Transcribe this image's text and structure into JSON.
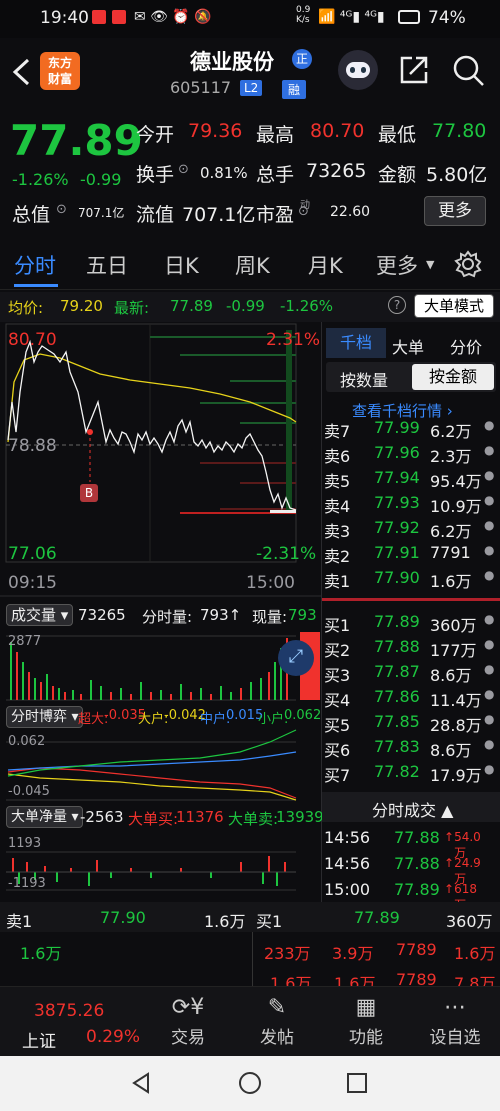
{
  "status": {
    "time": "19:40",
    "net_speed": "0.9\nK/s",
    "battery": "74%"
  },
  "header": {
    "brand": "东方\n财富",
    "stock_name": "德业股份",
    "stock_code": "605117",
    "badge_level": "L2",
    "badge_margin": "融",
    "badge_zheng": "正"
  },
  "quote": {
    "price": "77.89",
    "change_pct": "-1.26%",
    "change": "-0.99",
    "open_label": "今开",
    "open": "79.36",
    "high_label": "最高",
    "high": "80.70",
    "low_label": "最低",
    "low": "77.80",
    "turnover_label": "换手",
    "turnover": "0.81%",
    "volume_label": "总手",
    "volume": "73265",
    "amount_label": "金额",
    "amount": "5.80亿",
    "mktcap_label": "总值",
    "mktcap": "707.1亿",
    "float_label": "流值",
    "float": "707.1亿",
    "pe_label": "市盈",
    "pe_sup": "动",
    "pe": "22.60",
    "more": "更多"
  },
  "tabs": [
    "分时",
    "五日",
    "日K",
    "周K",
    "月K",
    "更多"
  ],
  "avgline": {
    "avg_label": "均价:",
    "avg": "79.20",
    "latest_label": "最新:",
    "latest": "77.89",
    "chg": "-0.99",
    "pct": "-1.26%",
    "big_order_mode": "大单模式"
  },
  "chart": {
    "price_high": "80.70",
    "pct_high": "2.31%",
    "prev_close": "78.88",
    "price_low": "77.06",
    "pct_low": "-2.31%",
    "time_start": "09:15",
    "time_end": "15:00",
    "b_marker": "B",
    "vol_label": "成交量",
    "vol_total": "73265",
    "vol_min_label": "分时量:",
    "vol_min": "793↑",
    "vol_now_label": "现量:",
    "vol_now": "793",
    "vol_max": "2877",
    "game_label": "分时博弈",
    "super_label": "超大:",
    "super": "-0.035",
    "large_label": "大户:",
    "large": "-0.042",
    "mid_label": "中户:",
    "mid": "0.015",
    "small_label": "小户:",
    "small": "0.062",
    "game_max": "0.062",
    "game_min": "-0.045",
    "net_label": "大单净量",
    "net": "-2563",
    "big_buy_label": "大单买:",
    "big_buy": "11376",
    "big_sell_label": "大单卖:",
    "big_sell": "13939",
    "net_max": "1193",
    "net_min": "-1193"
  },
  "book": {
    "tab_qian": "千档",
    "tab_big": "大单",
    "tab_price": "分价",
    "by_qty": "按数量",
    "by_amount": "按金额",
    "view_more": "查看千档行情 ›",
    "asks": [
      {
        "label": "卖7",
        "price": "77.99",
        "vol": "6.2万"
      },
      {
        "label": "卖6",
        "price": "77.96",
        "vol": "2.3万"
      },
      {
        "label": "卖5",
        "price": "77.94",
        "vol": "95.4万"
      },
      {
        "label": "卖4",
        "price": "77.93",
        "vol": "10.9万"
      },
      {
        "label": "卖3",
        "price": "77.92",
        "vol": "6.2万"
      },
      {
        "label": "卖2",
        "price": "77.91",
        "vol": "7791"
      },
      {
        "label": "卖1",
        "price": "77.90",
        "vol": "1.6万"
      }
    ],
    "bids": [
      {
        "label": "买1",
        "price": "77.89",
        "vol": "360万"
      },
      {
        "label": "买2",
        "price": "77.88",
        "vol": "177万"
      },
      {
        "label": "买3",
        "price": "77.87",
        "vol": "8.6万"
      },
      {
        "label": "买4",
        "price": "77.86",
        "vol": "11.4万"
      },
      {
        "label": "买5",
        "price": "77.85",
        "vol": "28.8万"
      },
      {
        "label": "买6",
        "price": "77.83",
        "vol": "8.6万"
      },
      {
        "label": "买7",
        "price": "77.82",
        "vol": "17.9万"
      }
    ],
    "trades_title": "分时成交 ▲",
    "trades": [
      {
        "time": "14:56",
        "price": "77.88",
        "vol": "54.0万"
      },
      {
        "time": "14:56",
        "price": "77.88",
        "vol": "24.9万"
      },
      {
        "time": "15:00",
        "price": "77.89",
        "vol": "618万"
      }
    ]
  },
  "footer": {
    "sell1_label": "卖1",
    "sell1_price": "77.90",
    "sell1_vol": "1.6万",
    "buy1_label": "买1",
    "buy1_price": "77.89",
    "buy1_vol": "360万",
    "row2_left": "1.6万",
    "row2_a": "233万",
    "row2_b": "3.9万",
    "row2_c": "7789",
    "row2_d": "1.6万",
    "row3_a": "1.6万",
    "row3_b": "1.6万",
    "row3_c": "7789",
    "row3_d": "7.8万"
  },
  "bottombar": {
    "index_value": "3875.26",
    "index_name": "上证",
    "index_pct": "0.29%",
    "trade": "交易",
    "post": "发帖",
    "func": "功能",
    "watch": "设自选"
  }
}
